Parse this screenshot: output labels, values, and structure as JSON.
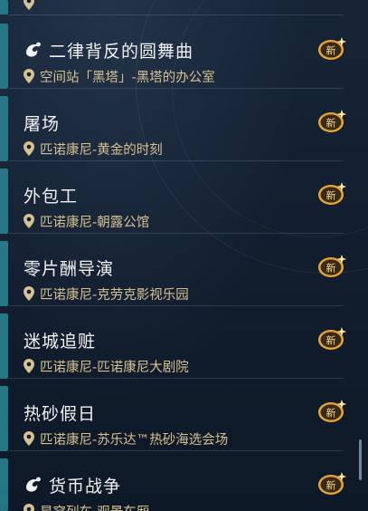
{
  "quests": [
    {
      "title": "",
      "location": "",
      "partial": true
    },
    {
      "title": "二律背反的圆舞曲",
      "location": "空间站「黑塔」-黑塔的办公室",
      "badge": "新",
      "lead_icon": "mission-icon"
    },
    {
      "title": "屠场",
      "location": "匹诺康尼-黄金的时刻",
      "badge": "新"
    },
    {
      "title": "外包工",
      "location": "匹诺康尼-朝露公馆",
      "badge": "新"
    },
    {
      "title": "零片酬导演",
      "location": "匹诺康尼-克劳克影视乐园",
      "badge": "新"
    },
    {
      "title": "迷城追赃",
      "location": "匹诺康尼-匹诺康尼大剧院",
      "badge": "新"
    },
    {
      "title": "热砂假日",
      "location": "匹诺康尼-苏乐达™热砂海选会场",
      "badge": "新"
    },
    {
      "title": "货币战争",
      "location": "星穹列车-观景车厢",
      "badge": "新",
      "lead_icon": "mission-icon"
    }
  ],
  "colors": {
    "background": "#111d2d",
    "title_text": "#f1f1ef",
    "location_text": "#d7c190",
    "badge_gold": "#e8a734",
    "rail_teal": "#2a7f8f"
  }
}
